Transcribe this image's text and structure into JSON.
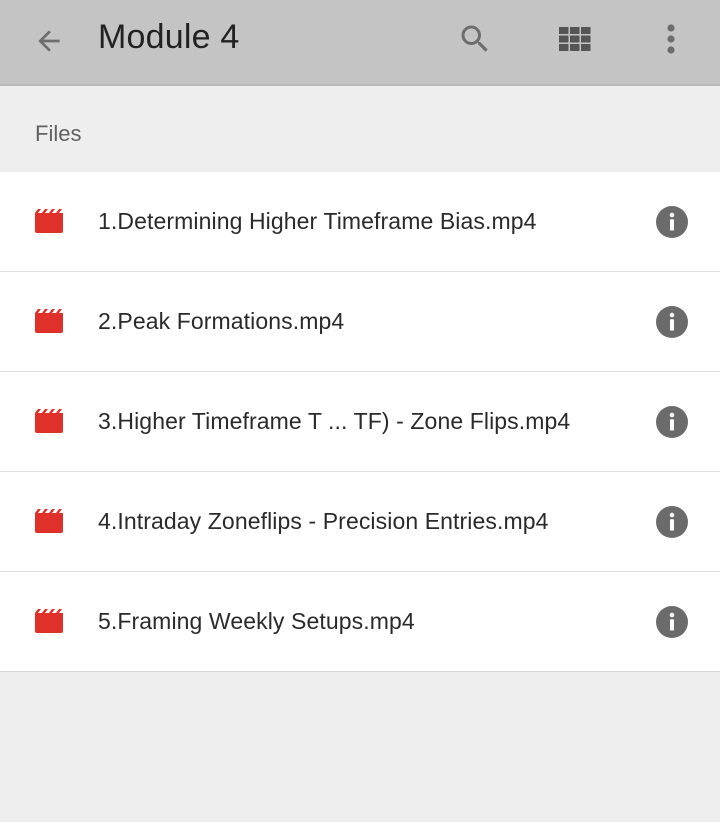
{
  "app_bar": {
    "title": "Module 4",
    "icons": {
      "back": "arrow-back-icon",
      "search": "search-icon",
      "grid": "grid-view-icon",
      "more": "more-vert-icon"
    },
    "background": "#c4c4c4"
  },
  "section": {
    "label": "Files"
  },
  "files": [
    {
      "name": "1.Determining Higher Timeframe Bias.mp4",
      "icon": "video-clapper-icon"
    },
    {
      "name": "2.Peak Formations.mp4",
      "icon": "video-clapper-icon"
    },
    {
      "name": "3.Higher Timeframe T ... TF) - Zone Flips.mp4",
      "icon": "video-clapper-icon"
    },
    {
      "name": "4.Intraday Zoneflips - Precision Entries.mp4",
      "icon": "video-clapper-icon"
    },
    {
      "name": "5.Framing Weekly Setups.mp4",
      "icon": "video-clapper-icon"
    }
  ],
  "colors": {
    "video_icon": "#e0302a",
    "info_icon": "#6b6b6b",
    "page_background": "#eeeeee"
  }
}
